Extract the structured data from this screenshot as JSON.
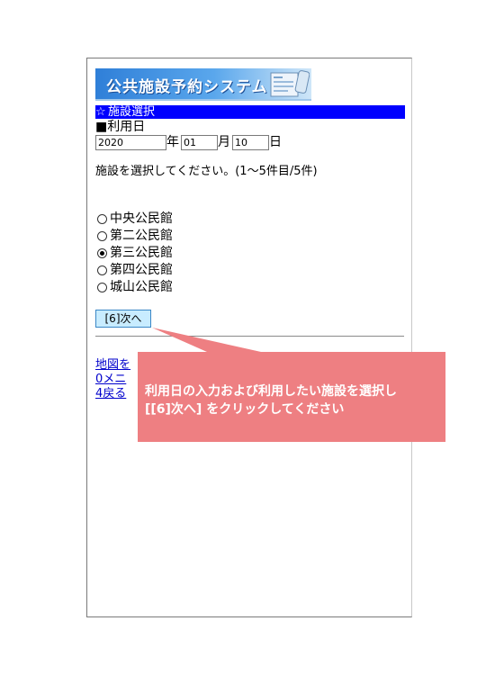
{
  "banner": {
    "title": "公共施設予約システム",
    "icon": "form-document-icon"
  },
  "section": {
    "symbol": "☆",
    "title": "施設選択"
  },
  "date": {
    "label": "■利用日",
    "year_value": "2020",
    "year_unit": "年",
    "month_value": "01",
    "month_unit": "月",
    "day_value": "10",
    "day_unit": "日"
  },
  "instruction": "施設を選択してください。(1〜5件目/5件)",
  "facilities": [
    {
      "label": "中央公民館",
      "checked": false
    },
    {
      "label": "第二公民館",
      "checked": false
    },
    {
      "label": "第三公民館",
      "checked": true
    },
    {
      "label": "第四公民館",
      "checked": false
    },
    {
      "label": "城山公民館",
      "checked": false
    }
  ],
  "next_button": "[6]次へ",
  "links": {
    "map": "地図を",
    "menu": "0メニ",
    "back": "4戻る"
  },
  "callout": {
    "line1": "利用日の入力および利用したい施設を選択し",
    "line2": "[[6]次へ] をクリックしてください"
  },
  "colors": {
    "section_bar": "#0000ff",
    "callout": "#ee7f82",
    "button_bg": "#c8ecff",
    "link": "#0000cc"
  }
}
